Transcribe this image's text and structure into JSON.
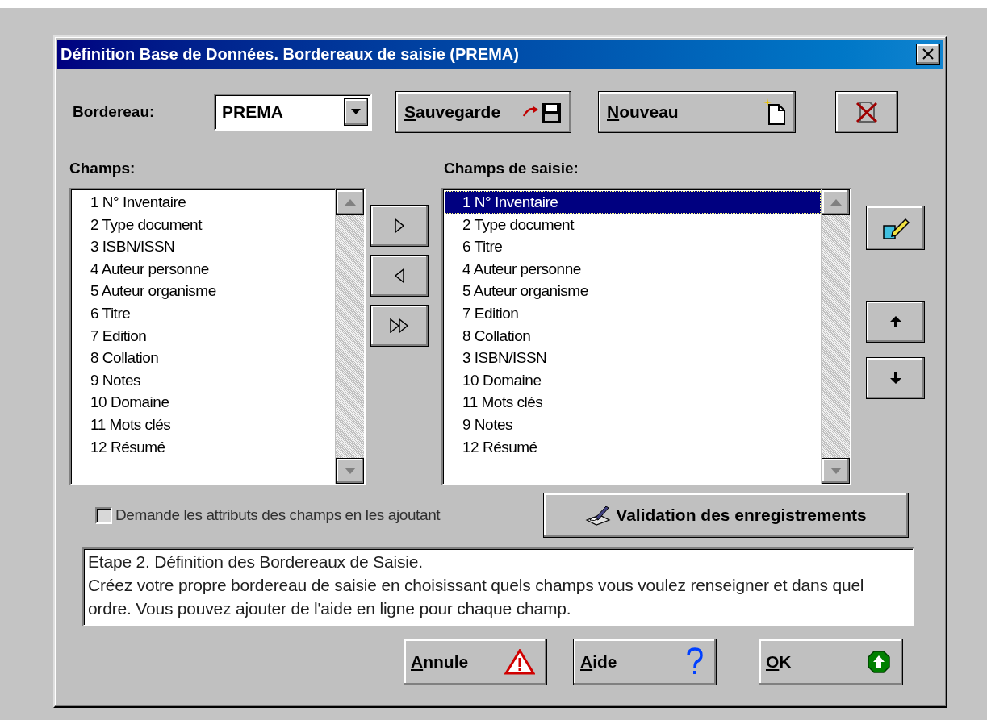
{
  "window": {
    "title": "Définition Base de Données. Bordereaux de saisie (PREMA)"
  },
  "bordereau": {
    "label": "Bordereau:",
    "value": "PREMA"
  },
  "toolbar_buttons": [
    {
      "kind": "save",
      "label": "Sauvegarde",
      "underline_first": true
    },
    {
      "kind": "new",
      "label": "Nouveau",
      "underline_first": true
    },
    {
      "kind": "delete"
    }
  ],
  "fields_list": {
    "label": "Champs:",
    "items": [
      {
        "text": "1 N° Inventaire",
        "selected": false
      },
      {
        "text": "2 Type document",
        "selected": false
      },
      {
        "text": "3 ISBN/ISSN",
        "selected": false
      },
      {
        "text": "4 Auteur personne",
        "selected": false
      },
      {
        "text": "5 Auteur organisme",
        "selected": false
      },
      {
        "text": "6 Titre",
        "selected": false
      },
      {
        "text": "7 Edition",
        "selected": false
      },
      {
        "text": "8 Collation",
        "selected": false
      },
      {
        "text": "9 Notes",
        "selected": false
      },
      {
        "text": "10 Domaine",
        "selected": false
      },
      {
        "text": "11 Mots clés",
        "selected": false
      },
      {
        "text": "12 Résumé",
        "selected": false
      }
    ]
  },
  "transfer_buttons": [
    {
      "kind": "add"
    },
    {
      "kind": "remove"
    },
    {
      "kind": "add_all"
    }
  ],
  "entry_list": {
    "label": "Champs de saisie:",
    "items": [
      {
        "text": "1 N° Inventaire",
        "selected": true
      },
      {
        "text": "2 Type document",
        "selected": false
      },
      {
        "text": "6 Titre",
        "selected": false
      },
      {
        "text": "4 Auteur personne",
        "selected": false
      },
      {
        "text": "5 Auteur organisme",
        "selected": false
      },
      {
        "text": "7 Edition",
        "selected": false
      },
      {
        "text": "8 Collation",
        "selected": false
      },
      {
        "text": "3 ISBN/ISSN",
        "selected": false
      },
      {
        "text": "10 Domaine",
        "selected": false
      },
      {
        "text": "11 Mots clés",
        "selected": false
      },
      {
        "text": "9 Notes",
        "selected": false
      },
      {
        "text": "12 Résumé",
        "selected": false
      }
    ]
  },
  "side_buttons": [
    {
      "kind": "edit"
    },
    {
      "kind": "up"
    },
    {
      "kind": "down"
    }
  ],
  "ask_attributes": {
    "label": "Demande les attributs des champs en les ajoutant",
    "checked": false
  },
  "validation_button": {
    "label": "Validation des enregistrements"
  },
  "description": {
    "title": "Etape 2. Définition des Bordereaux de Saisie.",
    "text": "Créez votre propre bordereau de saisie en choisissant quels champs vous voulez renseigner et dans quel ordre. Vous pouvez ajouter de l'aide en ligne pour chaque champ."
  },
  "dialog_buttons": [
    {
      "kind": "cancel",
      "label": "Annule",
      "underline_first": true
    },
    {
      "kind": "help",
      "label": "Aide",
      "underline_first": true
    },
    {
      "kind": "ok",
      "label": "OK",
      "underline_first": true
    }
  ]
}
